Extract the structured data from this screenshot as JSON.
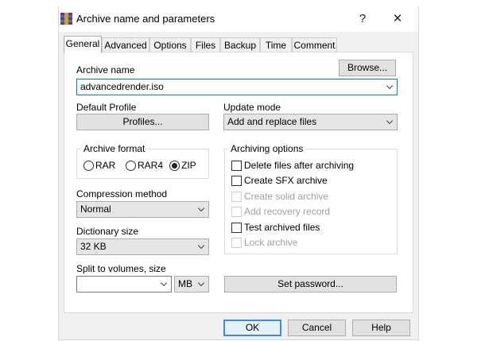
{
  "window": {
    "title": "Archive name and parameters",
    "help_glyph": "?",
    "close_glyph": "✕"
  },
  "tabs": [
    "General",
    "Advanced",
    "Options",
    "Files",
    "Backup",
    "Time",
    "Comment"
  ],
  "general": {
    "archive_name_label": "Archive name",
    "archive_name_value": "advancedrender.iso",
    "browse_label": "Browse...",
    "default_profile_label": "Default Profile",
    "profiles_label": "Profiles...",
    "update_mode_label": "Update mode",
    "update_mode_value": "Add and replace files",
    "archive_format_label": "Archive format",
    "formats": [
      {
        "label": "RAR",
        "selected": false
      },
      {
        "label": "RAR4",
        "selected": false
      },
      {
        "label": "ZIP",
        "selected": true
      }
    ],
    "archiving_options_label": "Archiving options",
    "options": [
      {
        "label": "Delete files after archiving",
        "checked": false,
        "enabled": true
      },
      {
        "label": "Create SFX archive",
        "checked": false,
        "enabled": true
      },
      {
        "label": "Create solid archive",
        "checked": false,
        "enabled": false
      },
      {
        "label": "Add recovery record",
        "checked": false,
        "enabled": false
      },
      {
        "label": "Test archived files",
        "checked": false,
        "enabled": true
      },
      {
        "label": "Lock archive",
        "checked": false,
        "enabled": false
      }
    ],
    "compression_method_label": "Compression method",
    "compression_method_value": "Normal",
    "dictionary_size_label": "Dictionary size",
    "dictionary_size_value": "32 KB",
    "split_label": "Split to volumes, size",
    "split_value": "",
    "split_unit": "MB",
    "set_password_label": "Set password..."
  },
  "footer": {
    "ok_label": "OK",
    "cancel_label": "Cancel",
    "help_label": "Help"
  },
  "colors": {
    "focus": "#0078d7",
    "default_button": "#3c8be8"
  }
}
